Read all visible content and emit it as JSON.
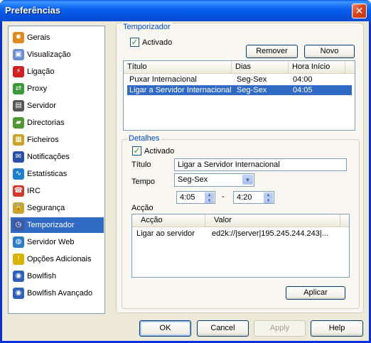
{
  "window": {
    "title": "Preferências",
    "close_glyph": "✕"
  },
  "sidebar": {
    "items": [
      {
        "label": "Gerais",
        "icon": "gear-icon",
        "color": "#e08a1e",
        "glyph": "✹"
      },
      {
        "label": "Visualização",
        "icon": "display-icon",
        "color": "#6a8fd0",
        "glyph": "▣"
      },
      {
        "label": "Ligação",
        "icon": "plug-icon",
        "color": "#d12020",
        "glyph": "⚡"
      },
      {
        "label": "Proxy",
        "icon": "proxy-icon",
        "color": "#3a9a3a",
        "glyph": "⇄"
      },
      {
        "label": "Servidor",
        "icon": "server-icon",
        "color": "#555555",
        "glyph": "▤"
      },
      {
        "label": "Directorias",
        "icon": "folder-icon",
        "color": "#4f9a2e",
        "glyph": "▰"
      },
      {
        "label": "Ficheiros",
        "icon": "files-icon",
        "color": "#c9a227",
        "glyph": "▦"
      },
      {
        "label": "Notificações",
        "icon": "notification-icon",
        "color": "#2a4fa8",
        "glyph": "✉"
      },
      {
        "label": "Estatísticas",
        "icon": "statistics-icon",
        "color": "#1e7fcf",
        "glyph": "∿"
      },
      {
        "label": "IRC",
        "icon": "irc-icon",
        "color": "#d13a2a",
        "glyph": "☎"
      },
      {
        "label": "Segurança",
        "icon": "lock-icon",
        "color": "#c8a533",
        "glyph": "🔒"
      },
      {
        "label": "Temporizador",
        "icon": "clock-icon",
        "color": "#3c5aa0",
        "glyph": "◷"
      },
      {
        "label": "Servidor Web",
        "icon": "web-server-icon",
        "color": "#2b7cc8",
        "glyph": "◍"
      },
      {
        "label": "Opções Adicionais",
        "icon": "warning-icon",
        "color": "#d8b400",
        "glyph": "!"
      },
      {
        "label": "Bowlfish",
        "icon": "bowlfish-icon",
        "color": "#2f62b7",
        "glyph": "◉"
      },
      {
        "label": "Bowlfish Avançado",
        "icon": "bowlfish-advanced-icon",
        "color": "#2f62b7",
        "glyph": "◉"
      }
    ],
    "selected_index": 11
  },
  "scheduler": {
    "group_title": "Temporizador",
    "enabled_label": "Activado",
    "enabled": true,
    "remove_label": "Remover",
    "new_label": "Novo",
    "columns": [
      "Título",
      "Dias",
      "Hora Início"
    ],
    "rows": [
      {
        "title": "Puxar Internacional",
        "days": "Seg-Sex",
        "start": "04:00"
      },
      {
        "title": "Ligar a Servidor Internacional",
        "days": "Seg-Sex",
        "start": "04:05"
      }
    ],
    "selected_row": 1
  },
  "details": {
    "group_title": "Detalhes",
    "enabled_label": "Activado",
    "enabled": true,
    "title_label": "Título",
    "title_value": "Ligar a Servidor Internacional",
    "time_label": "Tempo",
    "time_value": "Seg-Sex",
    "start_time": "4:05",
    "separator": "-",
    "end_time": "4:20",
    "action_label": "Acção",
    "action_columns": [
      "Acção",
      "Valor"
    ],
    "actions": [
      {
        "action": "Ligar ao servidor",
        "value": "ed2k://|server|195.245.244.243|..."
      }
    ],
    "apply_label": "Aplicar"
  },
  "footer": {
    "ok_label": "OK",
    "cancel_label": "Cancel",
    "apply_label": "Apply",
    "help_label": "Help"
  },
  "colors": {
    "titlebar": "#0a5ae6",
    "selection": "#316ac5",
    "group_title": "#0046d5",
    "dialog_bg": "#ece9d8"
  }
}
